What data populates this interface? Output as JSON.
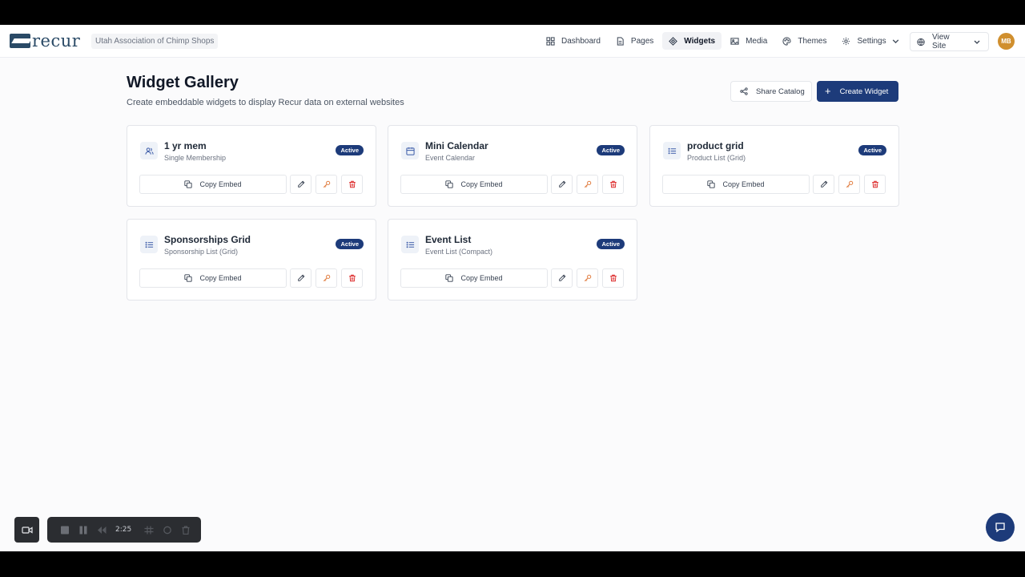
{
  "brand": {
    "name": "recur",
    "org": "Utah Association of Chimp Shops"
  },
  "nav": {
    "items": [
      {
        "label": "Dashboard",
        "icon": "grid-icon"
      },
      {
        "label": "Pages",
        "icon": "file-icon"
      },
      {
        "label": "Widgets",
        "icon": "widget-icon",
        "active": true
      },
      {
        "label": "Media",
        "icon": "image-icon"
      },
      {
        "label": "Themes",
        "icon": "palette-icon"
      },
      {
        "label": "Settings",
        "icon": "gear-icon"
      }
    ],
    "view_site": "View Site",
    "avatar": "MB"
  },
  "page": {
    "title": "Widget Gallery",
    "subtitle": "Create embeddable widgets to display Recur data on external websites",
    "share_label": "Share Catalog",
    "create_label": "Create Widget"
  },
  "widgets": [
    {
      "name": "1 yr mem",
      "type": "Single Membership",
      "status": "Active",
      "icon": "users-icon",
      "copy_label": "Copy Embed"
    },
    {
      "name": "Mini Calendar",
      "type": "Event Calendar",
      "status": "Active",
      "icon": "calendar-icon",
      "copy_label": "Copy Embed"
    },
    {
      "name": "product grid",
      "type": "Product List (Grid)",
      "status": "Active",
      "icon": "list-icon",
      "copy_label": "Copy Embed"
    },
    {
      "name": "Sponsorships Grid",
      "type": "Sponsorship List (Grid)",
      "status": "Active",
      "icon": "list-icon",
      "copy_label": "Copy Embed"
    },
    {
      "name": "Event List",
      "type": "Event List (Compact)",
      "status": "Active",
      "icon": "list-icon",
      "copy_label": "Copy Embed"
    }
  ],
  "recorder": {
    "time": "2:25"
  },
  "colors": {
    "accent": "#1d3b7a",
    "danger": "#dc2626",
    "key": "#e07a3c",
    "avatar": "#d08f2e"
  }
}
